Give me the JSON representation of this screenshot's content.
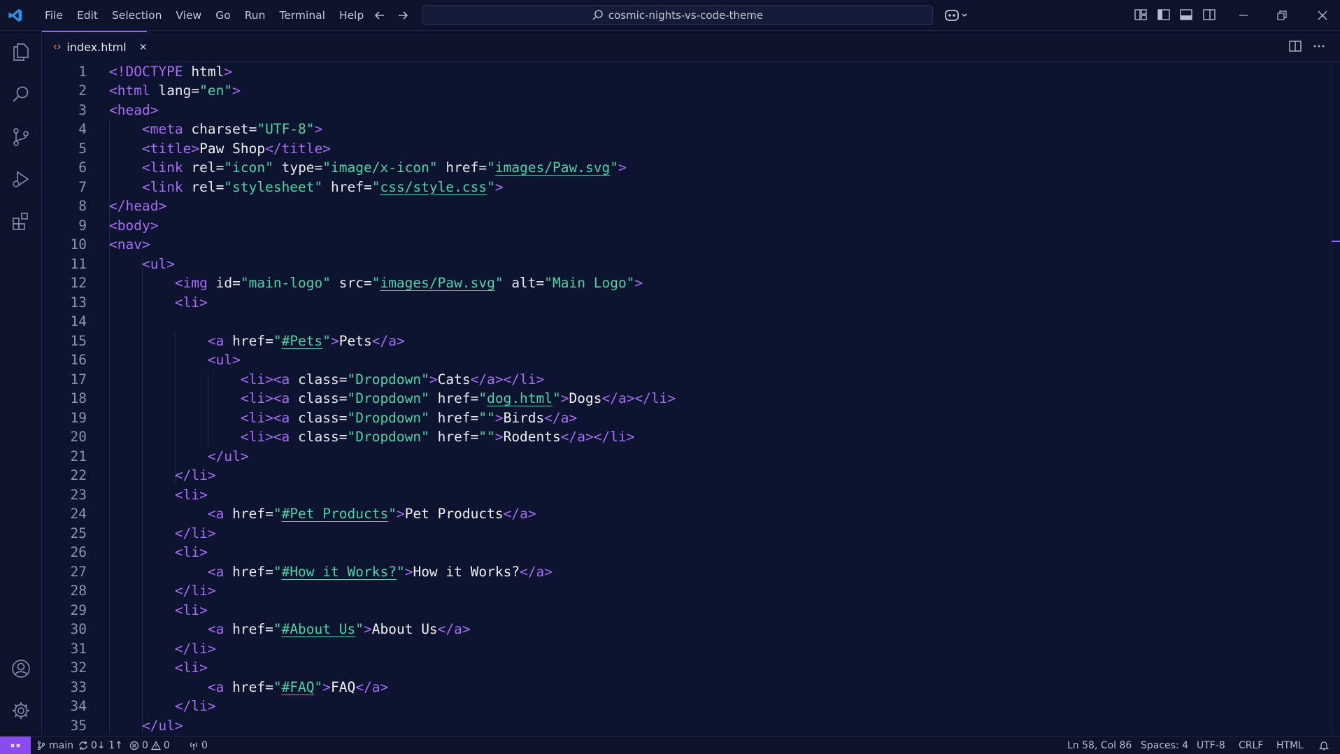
{
  "titlebar": {
    "menu": [
      "File",
      "Edit",
      "Selection",
      "View",
      "Go",
      "Run",
      "Terminal",
      "Help"
    ],
    "search_text": "cosmic-nights-vs-code-theme"
  },
  "tabs": [
    {
      "label": "index.html",
      "icon": "code-brackets-icon",
      "active": true
    }
  ],
  "code": [
    [
      [
        "tag",
        "<!DOCTYPE "
      ],
      [
        "attr",
        "html"
      ],
      [
        "tag",
        ">"
      ]
    ],
    [
      [
        "tag",
        "<html "
      ],
      [
        "attr",
        "lang="
      ],
      [
        "str",
        "\"en\""
      ],
      [
        "tag",
        ">"
      ]
    ],
    [
      [
        "tag",
        "<head>"
      ]
    ],
    [
      [
        "sp",
        "    "
      ],
      [
        "tag",
        "<meta "
      ],
      [
        "attr",
        "charset="
      ],
      [
        "str",
        "\"UTF-8\""
      ],
      [
        "tag",
        ">"
      ]
    ],
    [
      [
        "sp",
        "    "
      ],
      [
        "tag",
        "<title>"
      ],
      [
        "text",
        "Paw Shop"
      ],
      [
        "tag",
        "</title>"
      ]
    ],
    [
      [
        "sp",
        "    "
      ],
      [
        "tag",
        "<link "
      ],
      [
        "attr",
        "rel="
      ],
      [
        "str",
        "\"icon\""
      ],
      [
        "attr",
        " type="
      ],
      [
        "str",
        "\"image/x-icon\""
      ],
      [
        "attr",
        " href="
      ],
      [
        "str",
        "\""
      ],
      [
        "link",
        "images/Paw.svg"
      ],
      [
        "str",
        "\""
      ],
      [
        "tag",
        ">"
      ]
    ],
    [
      [
        "sp",
        "    "
      ],
      [
        "tag",
        "<link "
      ],
      [
        "attr",
        "rel="
      ],
      [
        "str",
        "\"stylesheet\""
      ],
      [
        "attr",
        " href="
      ],
      [
        "str",
        "\""
      ],
      [
        "link",
        "css/style.css"
      ],
      [
        "str",
        "\""
      ],
      [
        "tag",
        ">"
      ]
    ],
    [
      [
        "tag",
        "</head>"
      ]
    ],
    [
      [
        "tag",
        "<body>"
      ]
    ],
    [
      [
        "tag",
        "<nav>"
      ]
    ],
    [
      [
        "sp",
        "    "
      ],
      [
        "tag",
        "<ul>"
      ]
    ],
    [
      [
        "sp",
        "        "
      ],
      [
        "tag",
        "<img "
      ],
      [
        "attr",
        "id="
      ],
      [
        "str",
        "\"main-logo\""
      ],
      [
        "attr",
        " src="
      ],
      [
        "str",
        "\""
      ],
      [
        "link",
        "images/Paw.svg"
      ],
      [
        "str",
        "\""
      ],
      [
        "attr",
        " alt="
      ],
      [
        "str",
        "\"Main Logo\""
      ],
      [
        "tag",
        ">"
      ]
    ],
    [
      [
        "sp",
        "        "
      ],
      [
        "tag",
        "<li>"
      ]
    ],
    [],
    [
      [
        "sp",
        "            "
      ],
      [
        "tag",
        "<a "
      ],
      [
        "attr",
        "href="
      ],
      [
        "str",
        "\""
      ],
      [
        "link",
        "#Pets"
      ],
      [
        "str",
        "\""
      ],
      [
        "tag",
        ">"
      ],
      [
        "text",
        "Pets"
      ],
      [
        "tag",
        "</a>"
      ]
    ],
    [
      [
        "sp",
        "            "
      ],
      [
        "tag",
        "<ul>"
      ]
    ],
    [
      [
        "sp",
        "                "
      ],
      [
        "tag",
        "<li><a "
      ],
      [
        "attr",
        "class="
      ],
      [
        "str",
        "\"Dropdown\""
      ],
      [
        "tag",
        ">"
      ],
      [
        "text",
        "Cats"
      ],
      [
        "tag",
        "</a></li>"
      ]
    ],
    [
      [
        "sp",
        "                "
      ],
      [
        "tag",
        "<li><a "
      ],
      [
        "attr",
        "class="
      ],
      [
        "str",
        "\"Dropdown\""
      ],
      [
        "attr",
        " href="
      ],
      [
        "str",
        "\""
      ],
      [
        "link",
        "dog.html"
      ],
      [
        "str",
        "\""
      ],
      [
        "tag",
        ">"
      ],
      [
        "text",
        "Dogs"
      ],
      [
        "tag",
        "</a></li>"
      ]
    ],
    [
      [
        "sp",
        "                "
      ],
      [
        "tag",
        "<li><a "
      ],
      [
        "attr",
        "class="
      ],
      [
        "str",
        "\"Dropdown\""
      ],
      [
        "attr",
        " href="
      ],
      [
        "str",
        "\"\""
      ],
      [
        "tag",
        ">"
      ],
      [
        "text",
        "Birds"
      ],
      [
        "tag",
        "</a>"
      ]
    ],
    [
      [
        "sp",
        "                "
      ],
      [
        "tag",
        "<li><a "
      ],
      [
        "attr",
        "class="
      ],
      [
        "str",
        "\"Dropdown\""
      ],
      [
        "attr",
        " href="
      ],
      [
        "str",
        "\"\""
      ],
      [
        "tag",
        ">"
      ],
      [
        "text",
        "Rodents"
      ],
      [
        "tag",
        "</a></li>"
      ]
    ],
    [
      [
        "sp",
        "            "
      ],
      [
        "tag",
        "</ul>"
      ]
    ],
    [
      [
        "sp",
        "        "
      ],
      [
        "tag",
        "</li>"
      ]
    ],
    [
      [
        "sp",
        "        "
      ],
      [
        "tag",
        "<li>"
      ]
    ],
    [
      [
        "sp",
        "            "
      ],
      [
        "tag",
        "<a "
      ],
      [
        "attr",
        "href="
      ],
      [
        "str",
        "\""
      ],
      [
        "link",
        "#Pet Products"
      ],
      [
        "str",
        "\""
      ],
      [
        "tag",
        ">"
      ],
      [
        "text",
        "Pet Products"
      ],
      [
        "tag",
        "</a>"
      ]
    ],
    [
      [
        "sp",
        "        "
      ],
      [
        "tag",
        "</li>"
      ]
    ],
    [
      [
        "sp",
        "        "
      ],
      [
        "tag",
        "<li>"
      ]
    ],
    [
      [
        "sp",
        "            "
      ],
      [
        "tag",
        "<a "
      ],
      [
        "attr",
        "href="
      ],
      [
        "str",
        "\""
      ],
      [
        "link",
        "#How it Works?"
      ],
      [
        "str",
        "\""
      ],
      [
        "tag",
        ">"
      ],
      [
        "text",
        "How it Works?"
      ],
      [
        "tag",
        "</a>"
      ]
    ],
    [
      [
        "sp",
        "        "
      ],
      [
        "tag",
        "</li>"
      ]
    ],
    [
      [
        "sp",
        "        "
      ],
      [
        "tag",
        "<li>"
      ]
    ],
    [
      [
        "sp",
        "            "
      ],
      [
        "tag",
        "<a "
      ],
      [
        "attr",
        "href="
      ],
      [
        "str",
        "\""
      ],
      [
        "link",
        "#About Us"
      ],
      [
        "str",
        "\""
      ],
      [
        "tag",
        ">"
      ],
      [
        "text",
        "About Us"
      ],
      [
        "tag",
        "</a>"
      ]
    ],
    [
      [
        "sp",
        "        "
      ],
      [
        "tag",
        "</li>"
      ]
    ],
    [
      [
        "sp",
        "        "
      ],
      [
        "tag",
        "<li>"
      ]
    ],
    [
      [
        "sp",
        "            "
      ],
      [
        "tag",
        "<a "
      ],
      [
        "attr",
        "href="
      ],
      [
        "str",
        "\""
      ],
      [
        "link",
        "#FAQ"
      ],
      [
        "str",
        "\""
      ],
      [
        "tag",
        ">"
      ],
      [
        "text",
        "FAQ"
      ],
      [
        "tag",
        "</a>"
      ]
    ],
    [
      [
        "sp",
        "        "
      ],
      [
        "tag",
        "</li>"
      ]
    ],
    [
      [
        "sp",
        "    "
      ],
      [
        "tag",
        "</ul>"
      ]
    ]
  ],
  "statusbar": {
    "branch": "main",
    "sync": "0↓ 1↑",
    "errors": "0",
    "warnings": "0",
    "ports": "0",
    "cursor": "Ln 58, Col 86",
    "spaces": "Spaces: 4",
    "encoding": "UTF-8",
    "eol": "CRLF",
    "language": "HTML"
  },
  "colors": {
    "accent": "#8a6cf2",
    "background": "#0d1430",
    "tag": "#a96cf5",
    "string": "#4fd3a6"
  }
}
